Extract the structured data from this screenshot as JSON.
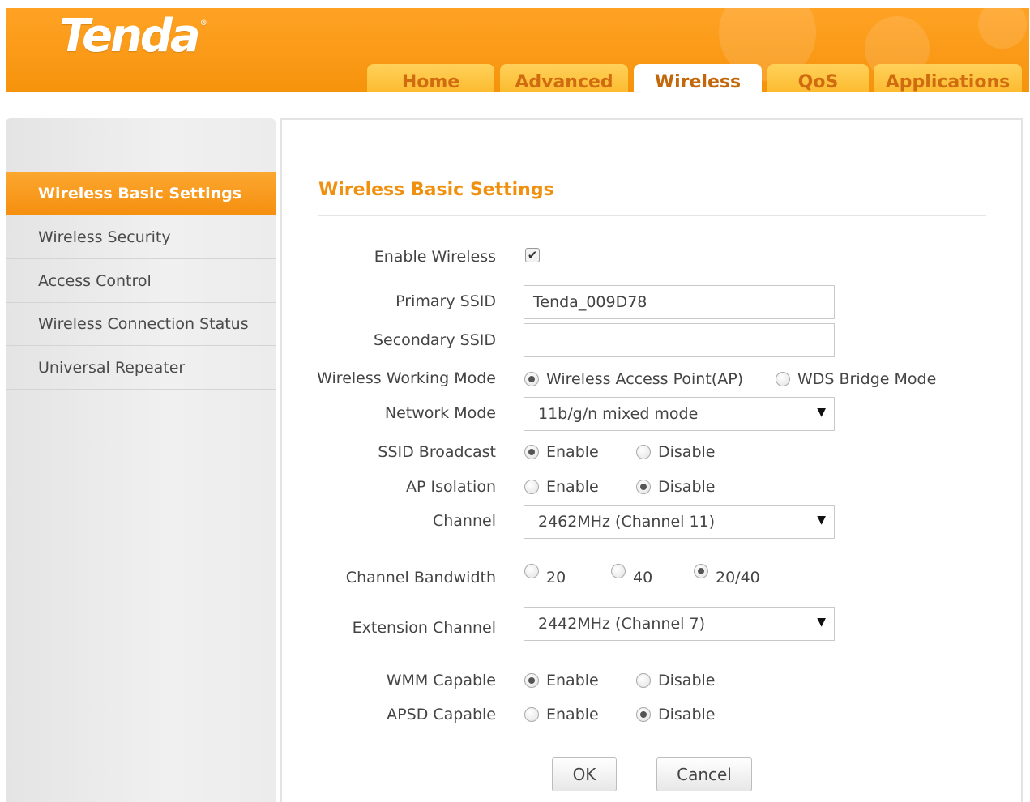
{
  "brand": {
    "logo_text": "Tenda",
    "trademark": "®"
  },
  "colors": {
    "accent": "#f6930c",
    "title": "#f0900f",
    "tab_face": "#fbb524",
    "tab_text": "#d06b10"
  },
  "nav": {
    "tabs": [
      {
        "label": "Home",
        "active": false
      },
      {
        "label": "Advanced",
        "active": false
      },
      {
        "label": "Wireless",
        "active": true
      },
      {
        "label": "QoS",
        "active": false
      },
      {
        "label": "Applications",
        "active": false
      }
    ]
  },
  "sidebar": {
    "items": [
      {
        "label": "Wireless Basic Settings",
        "active": true
      },
      {
        "label": "Wireless Security",
        "active": false
      },
      {
        "label": "Access Control",
        "active": false
      },
      {
        "label": "Wireless Connection Status",
        "active": false
      },
      {
        "label": "Universal Repeater",
        "active": false
      }
    ]
  },
  "main": {
    "title": "Wireless Basic Settings",
    "form": {
      "enable_wireless": {
        "label": "Enable Wireless",
        "checked": true,
        "check_glyph": "✔"
      },
      "primary_ssid": {
        "label": "Primary SSID",
        "value": "Tenda_009D78"
      },
      "secondary_ssid": {
        "label": "Secondary SSID",
        "value": ""
      },
      "working_mode": {
        "label": "Wireless Working Mode",
        "options": [
          "Wireless Access Point(AP)",
          "WDS Bridge Mode"
        ],
        "selected": "Wireless Access Point(AP)"
      },
      "network_mode": {
        "label": "Network Mode",
        "value": "11b/g/n mixed mode"
      },
      "ssid_broadcast": {
        "label": "SSID Broadcast",
        "options": [
          "Enable",
          "Disable"
        ],
        "selected": "Enable"
      },
      "ap_isolation": {
        "label": "AP Isolation",
        "options": [
          "Enable",
          "Disable"
        ],
        "selected": "Disable"
      },
      "channel": {
        "label": "Channel",
        "value": "2462MHz (Channel 11)"
      },
      "channel_bandwidth": {
        "label": "Channel Bandwidth",
        "options": [
          "20",
          "40",
          "20/40"
        ],
        "selected": "20/40"
      },
      "extension_channel": {
        "label": "Extension Channel",
        "value": "2442MHz (Channel 7)"
      },
      "wmm_capable": {
        "label": "WMM Capable",
        "options": [
          "Enable",
          "Disable"
        ],
        "selected": "Enable"
      },
      "apsd_capable": {
        "label": "APSD Capable",
        "options": [
          "Enable",
          "Disable"
        ],
        "selected": "Disable"
      }
    },
    "dropdown_glyph": "▼",
    "buttons": {
      "ok": "OK",
      "cancel": "Cancel"
    }
  },
  "icons": {
    "checkbox": "checkmark-icon",
    "dropdown": "chevron-down-icon"
  }
}
